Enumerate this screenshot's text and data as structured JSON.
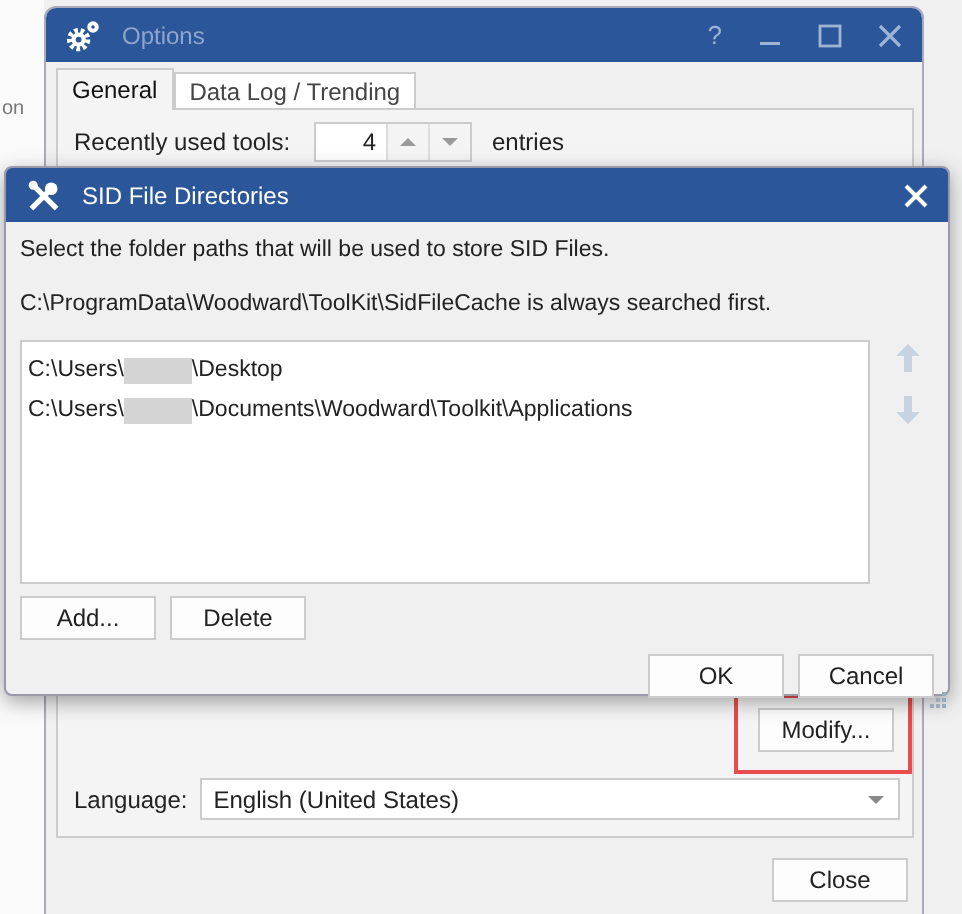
{
  "background": {
    "text": "on"
  },
  "options_window": {
    "title": "Options",
    "help": "?",
    "tabs": [
      {
        "label": "General",
        "selected": true
      },
      {
        "label": "Data Log / Trending",
        "selected": false
      }
    ],
    "recent_tools": {
      "label": "Recently used tools:",
      "value": "4",
      "unit": "entries"
    },
    "modify_button": {
      "label": "Modify...",
      "highlighted": true
    },
    "language": {
      "label": "Language:",
      "value": "English (United States)"
    },
    "close_button": "Close"
  },
  "sid_dialog": {
    "title": "SID File Directories",
    "instruction": "Select the folder paths that will be used to store SID Files.",
    "note": "C:\\ProgramData\\Woodward\\ToolKit\\SidFileCache is always searched first.",
    "paths": [
      {
        "prefix": "C:\\Users\\",
        "suffix": "\\Desktop"
      },
      {
        "prefix": "C:\\Users\\",
        "suffix": "\\Documents\\Woodward\\Toolkit\\Applications"
      }
    ],
    "list_buttons": [
      "Add...",
      "Delete"
    ],
    "dialog_buttons": [
      "OK",
      "Cancel"
    ]
  }
}
